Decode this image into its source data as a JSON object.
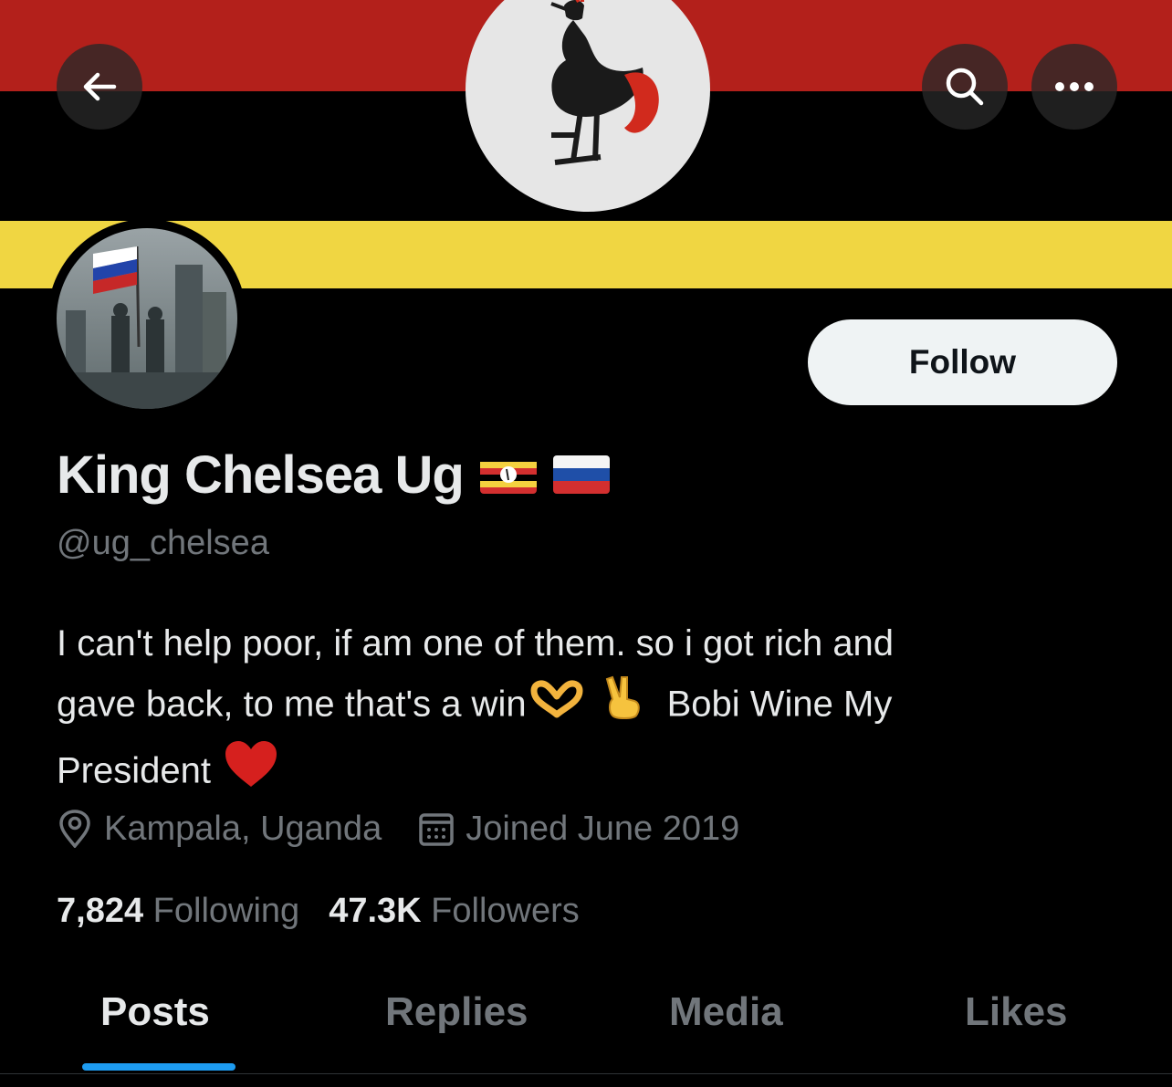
{
  "profile": {
    "display_name": "King Chelsea Ug",
    "handle": "@ug_chelsea",
    "bio_line1": "I can't help poor, if am one of them. so i got rich and",
    "bio_line2_a": "gave back, to me that's a win",
    "bio_line2_b": "Bobi Wine My",
    "bio_line3": "President",
    "location": "Kampala, Uganda",
    "joined": "Joined June 2019",
    "following_count": "7,824",
    "following_label": "Following",
    "followers_count": "47.3K",
    "followers_label": "Followers",
    "flags": [
      "uganda-flag-emoji",
      "russia-flag-emoji"
    ],
    "bio_emojis": [
      "heart-hands-emoji",
      "victory-hand-emoji",
      "red-heart-emoji"
    ]
  },
  "actions": {
    "follow_label": "Follow",
    "icons": [
      "back-arrow-icon",
      "search-icon",
      "more-icon"
    ]
  },
  "tabs": [
    {
      "label": "Posts",
      "active": true
    },
    {
      "label": "Replies",
      "active": false
    },
    {
      "label": "Media",
      "active": false
    },
    {
      "label": "Likes",
      "active": false
    }
  ],
  "colors": {
    "background": "#000000",
    "primary_text": "#e7e9ea",
    "secondary_text": "#71767b",
    "accent": "#1d9bf0",
    "banner_red": "#b3201b",
    "banner_yellow": "#f0d642"
  }
}
